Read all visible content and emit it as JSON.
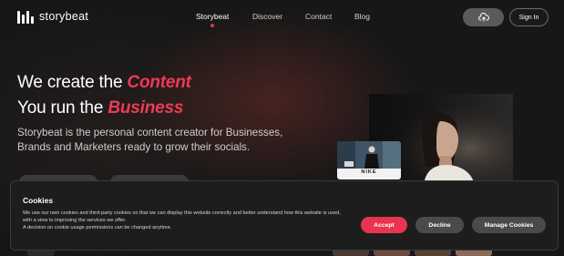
{
  "header": {
    "logo_text": "storybeat",
    "nav": [
      {
        "label": "Storybeat",
        "active": true
      },
      {
        "label": "Discover",
        "active": false
      },
      {
        "label": "Contact",
        "active": false
      },
      {
        "label": "Blog",
        "active": false
      }
    ],
    "upload_icon": "cloud-upload-icon",
    "signin_label": "Sign In"
  },
  "hero": {
    "line1_prefix": "We create the ",
    "line1_highlight": "Content",
    "line2_prefix": "You run the ",
    "line2_highlight": "Business",
    "subtitle": "Storybeat is the personal content creator for Businesses, Brands and Marketers ready to grow their socials.",
    "card_label": "NIKE"
  },
  "cookie_banner": {
    "title": "Cookies",
    "text_line1": "We use our own cookies and third-party cookies so that we can display this website correctly and better understand how this website is used, with a view to improving the services we offer.",
    "text_line2": "A decision on cookie usage permissions can be changed anytime.",
    "accept_label": "Accept",
    "decline_label": "Decline",
    "manage_label": "Manage Cookies"
  },
  "colors": {
    "accent": "#e8344e",
    "background": "#171717",
    "button_gray": "#4a4a4a"
  }
}
